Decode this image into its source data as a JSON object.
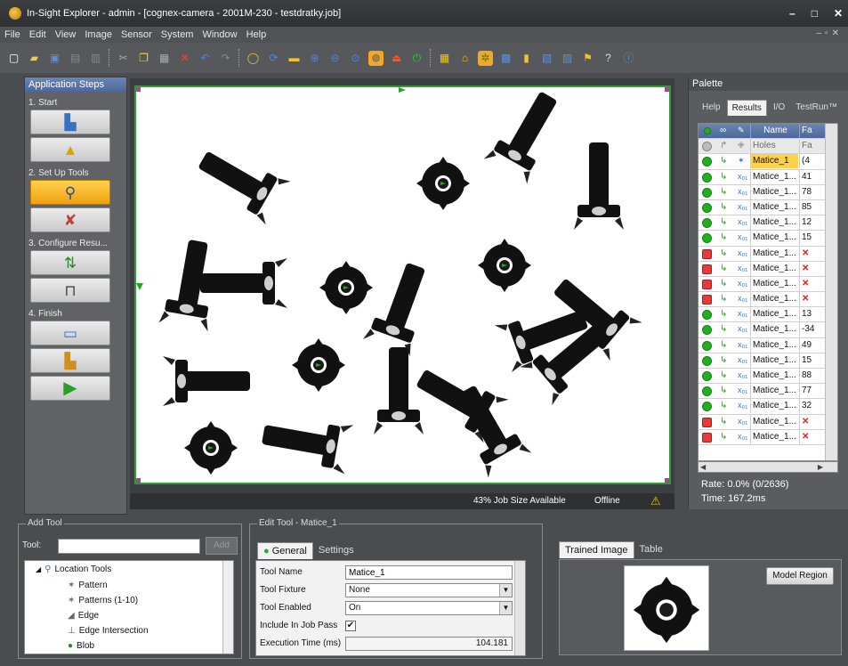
{
  "window": {
    "title": "In-Sight Explorer - admin - [cognex-camera - 2001M-230 - testdratky.job]",
    "controls": [
      "–",
      "□",
      "✕"
    ]
  },
  "menu": [
    "File",
    "Edit",
    "View",
    "Image",
    "Sensor",
    "System",
    "Window",
    "Help"
  ],
  "toolbar_icons": [
    "new-icon",
    "open-icon",
    "save-icon",
    "print-icon",
    "print-preview-icon",
    "cut-icon",
    "copy-icon",
    "paste-icon",
    "delete-icon",
    "undo-icon",
    "redo-icon",
    "live-icon",
    "online-icon",
    "camera-icon",
    "zoom-in-icon",
    "zoom-out-icon",
    "zoom-fit-icon",
    "zoom-active-icon",
    "trigger-icon",
    "power-icon",
    "grid-icon",
    "home-icon",
    "graphics-icon",
    "filmstrip-icon",
    "notes-icon",
    "job-icon",
    "spreadsheet-icon",
    "flag-icon",
    "help-icon",
    "info-icon"
  ],
  "app_steps": {
    "header": "Application Steps",
    "sections": [
      {
        "label": "1. Start",
        "buttons": [
          "camera-connect-icon",
          "set-up-image-icon"
        ]
      },
      {
        "label": "2. Set Up Tools",
        "buttons": [
          "locate-part-icon",
          "inspect-part-icon"
        ]
      },
      {
        "label": "3. Configure Resu...",
        "buttons": [
          "inputs-outputs-icon",
          "communication-icon"
        ]
      },
      {
        "label": "4. Finish",
        "buttons": [
          "filmstrip-icon",
          "save-job-icon",
          "run-job-icon"
        ]
      }
    ]
  },
  "image_status": {
    "job_size": "43% Job Size Available",
    "state": "Offline"
  },
  "palette": {
    "header": "Palette",
    "tabs": [
      "Help",
      "Results",
      "I/O",
      "TestRun™"
    ],
    "columns": [
      "Name",
      "Fa"
    ],
    "subheader": {
      "name": "Holes",
      "value": "Fa"
    },
    "rows": [
      {
        "status": "pass",
        "name": "Matice_1",
        "value": "(4"
      },
      {
        "status": "pass",
        "name": "Matice_1...",
        "value": "41"
      },
      {
        "status": "pass",
        "name": "Matice_1...",
        "value": "78"
      },
      {
        "status": "pass",
        "name": "Matice_1...",
        "value": "85"
      },
      {
        "status": "pass",
        "name": "Matice_1...",
        "value": "12"
      },
      {
        "status": "pass",
        "name": "Matice_1...",
        "value": "15"
      },
      {
        "status": "fail",
        "name": "Matice_1...",
        "value": "✕"
      },
      {
        "status": "fail",
        "name": "Matice_1...",
        "value": "✕"
      },
      {
        "status": "fail",
        "name": "Matice_1...",
        "value": "✕"
      },
      {
        "status": "fail",
        "name": "Matice_1...",
        "value": "✕"
      },
      {
        "status": "pass",
        "name": "Matice_1...",
        "value": "13"
      },
      {
        "status": "pass",
        "name": "Matice_1...",
        "value": "-34"
      },
      {
        "status": "pass",
        "name": "Matice_1...",
        "value": "49"
      },
      {
        "status": "pass",
        "name": "Matice_1...",
        "value": "15"
      },
      {
        "status": "pass",
        "name": "Matice_1...",
        "value": "88"
      },
      {
        "status": "pass",
        "name": "Matice_1...",
        "value": "77"
      },
      {
        "status": "pass",
        "name": "Matice_1...",
        "value": "32"
      },
      {
        "status": "fail",
        "name": "Matice_1...",
        "value": "✕"
      },
      {
        "status": "fail",
        "name": "Matice_1...",
        "value": "✕"
      }
    ],
    "rate": "Rate: 0.0% (0/2636)",
    "time": "Time: 167.2ms"
  },
  "add_tool": {
    "title": "Add Tool",
    "tool_label": "Tool:",
    "tool_value": "",
    "add_button": "Add",
    "tree": {
      "root": "Location Tools",
      "children": [
        "Pattern",
        "Patterns (1-10)",
        "Edge",
        "Edge Intersection",
        "Blob"
      ]
    }
  },
  "edit_tool": {
    "title": "Edit Tool - Matice_1",
    "tabs": [
      "General",
      "Settings"
    ],
    "fields": {
      "tool_name_label": "Tool Name",
      "tool_name": "Matice_1",
      "fixture_label": "Tool Fixture",
      "fixture": "None",
      "enabled_label": "Tool Enabled",
      "enabled": "On",
      "include_label": "Include In Job Pass",
      "include_checked": "✔",
      "exec_label": "Execution Time (ms)",
      "exec_time": "104.181"
    }
  },
  "trained": {
    "tabs": [
      "Trained Image",
      "Table"
    ],
    "model_region": "Model Region"
  },
  "colors": {
    "accent": "#f5a623",
    "pass": "#20b020",
    "fail": "#e53b3b",
    "frame": "#2aa12a",
    "header_blue": "#4d679a"
  }
}
